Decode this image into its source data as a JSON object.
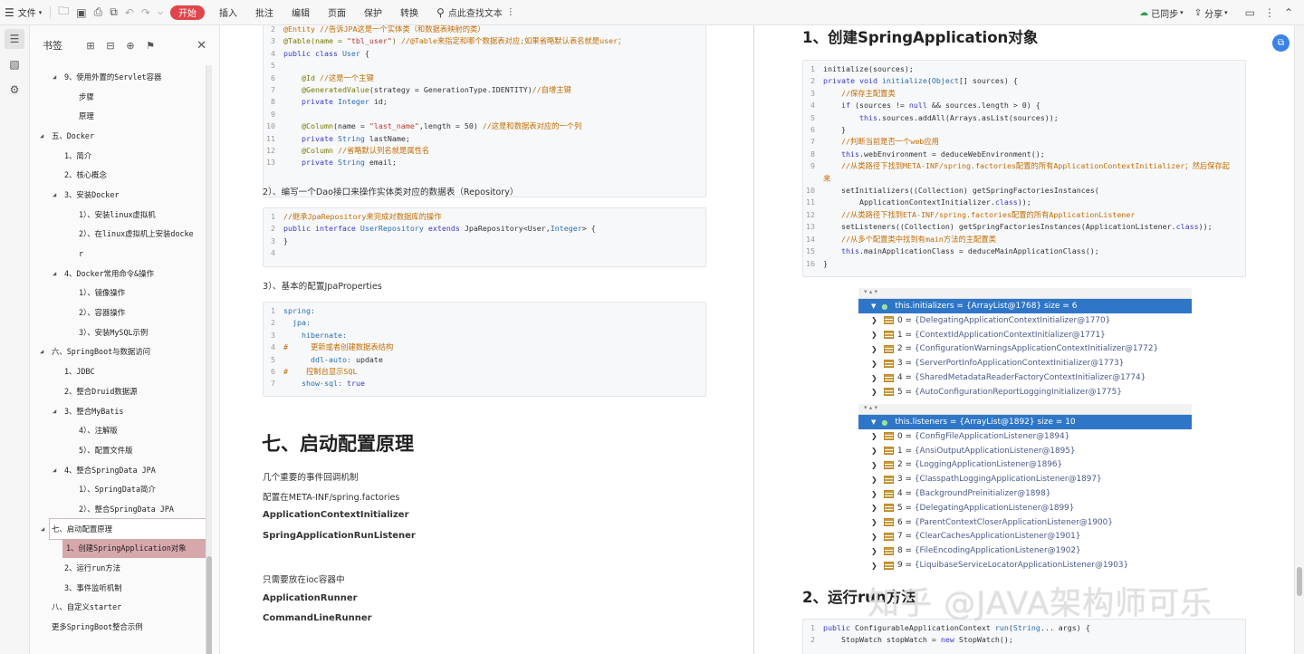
{
  "toolbar": {
    "file": "文件",
    "start": "开始",
    "insert": "插入",
    "annotate": "批注",
    "edit": "编辑",
    "page": "页面",
    "protect": "保护",
    "convert": "转换",
    "search_placeholder": "点此查找文本",
    "synced": "已同步",
    "share": "分享"
  },
  "panel": {
    "title": "书签"
  },
  "bookmarks": [
    {
      "label": "9、使用外置的Servlet容器",
      "lvl": 2,
      "tog": "down"
    },
    {
      "label": "步骤",
      "lvl": 3
    },
    {
      "label": "原理",
      "lvl": 3
    },
    {
      "label": "五、Docker",
      "lvl": 1,
      "tog": "down"
    },
    {
      "label": "1、简介",
      "lvl": 2
    },
    {
      "label": "2、核心概念",
      "lvl": 2
    },
    {
      "label": "3、安装Docker",
      "lvl": 2,
      "tog": "down"
    },
    {
      "label": "1）、安装linux虚拟机",
      "lvl": 3
    },
    {
      "label": "2）、在linux虚拟机上安装docke",
      "lvl": 3
    },
    {
      "label": "r",
      "lvl": 3,
      "cont": true
    },
    {
      "label": "4、Docker常用命令&操作",
      "lvl": 2,
      "tog": "down"
    },
    {
      "label": "1）、镜像操作",
      "lvl": 3
    },
    {
      "label": "2）、容器操作",
      "lvl": 3
    },
    {
      "label": "3）、安装MySQL示例",
      "lvl": 3
    },
    {
      "label": "六、SpringBoot与数据访问",
      "lvl": 1,
      "tog": "down"
    },
    {
      "label": "1、JDBC",
      "lvl": 2
    },
    {
      "label": "2、整合Druid数据源",
      "lvl": 2
    },
    {
      "label": "3、整合MyBatis",
      "lvl": 2,
      "tog": "down"
    },
    {
      "label": "4）、注解版",
      "lvl": 3
    },
    {
      "label": "5）、配置文件版",
      "lvl": 3
    },
    {
      "label": "4、整合SpringData JPA",
      "lvl": 2,
      "tog": "down"
    },
    {
      "label": "1）、SpringData简介",
      "lvl": 3
    },
    {
      "label": "2）、整合SpringData JPA",
      "lvl": 3
    },
    {
      "label": "七、启动配置原理",
      "lvl": 1,
      "tog": "down",
      "cur": true
    },
    {
      "label": "1、创建SpringApplication对象",
      "lvl": 2,
      "sel": true
    },
    {
      "label": "2、运行run方法",
      "lvl": 2
    },
    {
      "label": "3、事件监听机制",
      "lvl": 2
    },
    {
      "label": "八、自定义starter",
      "lvl": 1
    },
    {
      "label": "更多SpringBoot整合示例",
      "lvl": 1
    }
  ],
  "left": {
    "code1": [
      [
        "2",
        "[c]@Entity //告诉JPA这是一个实体类（和数据表映射的类）"
      ],
      [
        "3",
        "[a]@Table(name = [s]\"tbl_user\"[a]) [c]//@Table来指定和哪个数据表对应;如果省略默认表名就是user；"
      ],
      [
        "4",
        "[k]public class [y]User[n] {"
      ],
      [
        "5",
        ""
      ],
      [
        "6",
        "    [a]@Id [c]//这是一个主键"
      ],
      [
        "7",
        "    [a]@GeneratedValue[n](strategy = GenerationType.IDENTITY)[c]//自增主键"
      ],
      [
        "8",
        "    [k]private [y]Integer[n] id;"
      ],
      [
        "9",
        ""
      ],
      [
        "10",
        "    [a]@Column[n](name = [s]\"last_name\"[n],length = 50) [c]//这是和数据表对应的一个列"
      ],
      [
        "11",
        "    [k]private [y]String[n] lastName;"
      ],
      [
        "12",
        "    [a]@Column [c]//省略默认列名就是属性名"
      ],
      [
        "13",
        "    [k]private [y]String[n] email;"
      ]
    ],
    "p2": "2）、编写一个Dao接口来操作实体类对应的数据表（Repository）",
    "code2": [
      [
        "1",
        "[c]//继承JpaRepository来完成对数据库的操作"
      ],
      [
        "2",
        "[k]public interface [y]UserRepository [k]extends [n]JpaRepository<User,[y]Integer[n]> {"
      ],
      [
        "3",
        "}"
      ],
      [
        "4",
        ""
      ]
    ],
    "p3": "3）、基本的配置JpaProperties",
    "code3": [
      [
        "1",
        "[y]spring:"
      ],
      [
        "2",
        "  [y]jpa:"
      ],
      [
        "3",
        "    [y]hibernate:"
      ],
      [
        "4",
        "[c]#     更新或者创建数据表结构"
      ],
      [
        "5",
        "      [y]ddl-auto:[n] update"
      ],
      [
        "6",
        "[c]#    控制台显示SQL"
      ],
      [
        "7",
        "    [y]show-sql:[n] [k]true"
      ]
    ],
    "h_seven": "七、启动配置原理",
    "lines": [
      "几个重要的事件回调机制",
      "配置在META-INF/spring.factories",
      "ApplicationContextInitializer",
      "SpringApplicationRunListener",
      "只需要放在ioc容器中",
      "ApplicationRunner",
      "CommandLineRunner"
    ]
  },
  "right": {
    "h_create": "1、创建SpringApplication对象",
    "code4": [
      [
        "1",
        "initialize(sources);"
      ],
      [
        "2",
        "[k]private void [y]initialize[n]([y]Object[n][] sources) {"
      ],
      [
        "3",
        "    [c]//保存主配置类"
      ],
      [
        "4",
        "    [k]if[n] (sources != [k]null[n] && sources.length > 0) {"
      ],
      [
        "5",
        "        [k]this[n].sources.addAll(Arrays.asList(sources));"
      ],
      [
        "6",
        "    }"
      ],
      [
        "7",
        "    [c]//判断当前是否一个web应用"
      ],
      [
        "8",
        "    [k]this[n].webEnvironment = deduceWebEnvironment();"
      ],
      [
        "9",
        "    [c]//从类路径下找到META-INF/spring.factories配置的所有ApplicationContextInitializer；然后保存起"
      ],
      [
        "",
        "[c]来"
      ],
      [
        "10",
        "    setInitializers((Collection) getSpringFactoriesInstances("
      ],
      [
        "11",
        "        ApplicationContextInitializer.[k]class[n]));"
      ],
      [
        "12",
        "    [c]//从类路径下找到ETA-INF/spring.factories配置的所有ApplicationListener"
      ],
      [
        "13",
        "    setListeners((Collection) getSpringFactoriesInstances(ApplicationListener.[k]class[n]));"
      ],
      [
        "14",
        "    [c]//从多个配置类中找到有main方法的主配置类"
      ],
      [
        "15",
        "    [k]this[n].mainApplicationClass = deduceMainApplicationClass();"
      ],
      [
        "16",
        "}"
      ]
    ],
    "dbg1": {
      "header": "this.initializers = {ArrayList@1768}  size = 6",
      "items": [
        {
          "i": "0",
          "v": "{DelegatingApplicationContextInitializer@1770}"
        },
        {
          "i": "1",
          "v": "{ContextIdApplicationContextInitializer@1771}"
        },
        {
          "i": "2",
          "v": "{ConfigurationWarningsApplicationContextInitializer@1772}"
        },
        {
          "i": "3",
          "v": "{ServerPortInfoApplicationContextInitializer@1773}"
        },
        {
          "i": "4",
          "v": "{SharedMetadataReaderFactoryContextInitializer@1774}"
        },
        {
          "i": "5",
          "v": "{AutoConfigurationReportLoggingInitializer@1775}"
        }
      ]
    },
    "dbg2": {
      "header": "this.listeners = {ArrayList@1892}  size = 10",
      "items": [
        {
          "i": "0",
          "v": "{ConfigFileApplicationListener@1894}"
        },
        {
          "i": "1",
          "v": "{AnsiOutputApplicationListener@1895}"
        },
        {
          "i": "2",
          "v": "{LoggingApplicationListener@1896}"
        },
        {
          "i": "3",
          "v": "{ClasspathLoggingApplicationListener@1897}"
        },
        {
          "i": "4",
          "v": "{BackgroundPreinitializer@1898}"
        },
        {
          "i": "5",
          "v": "{DelegatingApplicationListener@1899}"
        },
        {
          "i": "6",
          "v": "{ParentContextCloserApplicationListener@1900}"
        },
        {
          "i": "7",
          "v": "{ClearCachesApplicationListener@1901}"
        },
        {
          "i": "8",
          "v": "{FileEncodingApplicationListener@1902}"
        },
        {
          "i": "9",
          "v": "{LiquibaseServiceLocatorApplicationListener@1903}"
        }
      ]
    },
    "h_run": "2、运行run方法",
    "code5": [
      [
        "1",
        "[k]public[n] ConfigurableApplicationContext [y]run[n]([y]String[n]... args) {"
      ],
      [
        "2",
        "    StopWatch stopWatch = [k]new[n] StopWatch();"
      ]
    ]
  },
  "watermark": "知乎 @JAVA架构师可乐"
}
